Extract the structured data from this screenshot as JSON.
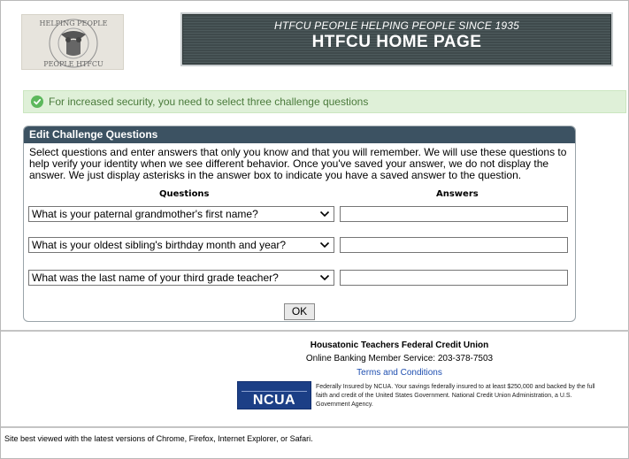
{
  "header": {
    "logo_text": "HELPING PEOPLE HTFCU",
    "tagline": "HTFCU PEOPLE HELPING PEOPLE SINCE 1935",
    "title": "HTFCU HOME PAGE"
  },
  "notice": {
    "text": "For increased security, you need to select three challenge questions",
    "icon": "check-circle-icon",
    "color": "#dff0d8"
  },
  "panel": {
    "title": "Edit Challenge Questions",
    "intro": "Select questions and enter answers that only you know and that you will remember. We will use these questions to help verify your identity when we see different behavior. Once you've saved your answer, we do not display the answer. We just display asterisks in the answer box to indicate you have a saved answer to the question.",
    "col_questions": "Questions",
    "col_answers": "Answers",
    "questions": [
      {
        "selected": "What is your paternal grandmother's first name?",
        "answer": ""
      },
      {
        "selected": "What is your oldest sibling's birthday month and year?",
        "answer": ""
      },
      {
        "selected": "What was the last name of your third grade teacher?",
        "answer": ""
      }
    ],
    "ok_label": "OK"
  },
  "footer": {
    "org_name": "Housatonic Teachers Federal Credit Union",
    "service": "Online Banking Member Service: 203-378-7503",
    "terms": "Terms and Conditions",
    "ncua_label": "NCUA",
    "ncua_text": "Federally Insured by NCUA. Your savings federally insured to at least $250,000 and backed by the full faith and credit of the United States Government. National Credit Union Administration, a U.S. Government Agency.",
    "site_note": "Site best viewed with the latest versions of Chrome, Firefox, Internet Explorer, or Safari."
  },
  "colors": {
    "panel_header": "#3c5262",
    "banner": "#4d5a5c",
    "link": "#1f4fb0"
  }
}
